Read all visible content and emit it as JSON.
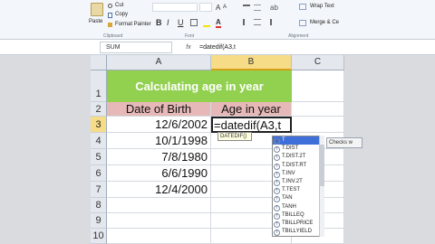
{
  "ribbon": {
    "cut_label": "Cut",
    "copy_label": "Copy",
    "paste_label": "Paste",
    "format_painter_label": "Format Painter",
    "clipboard_group": "Clipboard",
    "font_group": "Font",
    "alignment_group": "Alignment",
    "bold": "B",
    "italic": "I",
    "underline": "U",
    "wrap_text_label": "Wrap Text",
    "merge_label": "Merge & Ce"
  },
  "formula_bar": {
    "name_box": "SUM",
    "fx": "fx",
    "formula": "=datedif(A3,t"
  },
  "columns": [
    "A",
    "B",
    "C"
  ],
  "rows": [
    "1",
    "2",
    "3",
    "4",
    "5",
    "6",
    "7",
    "8",
    "9",
    "10"
  ],
  "sheet": {
    "title": "Calculating age in year",
    "header_dob": "Date of Birth",
    "header_age": "Age in year",
    "editing_cell": "=datedif(A3,t",
    "dates": [
      "12/6/2002",
      "10/1/1998",
      "7/8/1980",
      "6/6/1990",
      "12/4/2000"
    ]
  },
  "autocomplete": {
    "tooltip": "DATEDIF()",
    "items": [
      "T",
      "T.DIST",
      "T.DIST.2T",
      "T.DIST.RT",
      "T.INV",
      "T.INV.2T",
      "T.TEST",
      "TAN",
      "TANH",
      "TBILLEQ",
      "TBILLPRICE",
      "TBILLYIELD"
    ],
    "side_tip": "Checks w"
  },
  "colors": {
    "title_fill": "#92d050",
    "header_fill": "#e6b9b8",
    "selected_header": "#f7dc88",
    "autocomplete_selected": "#3f6fd9"
  }
}
